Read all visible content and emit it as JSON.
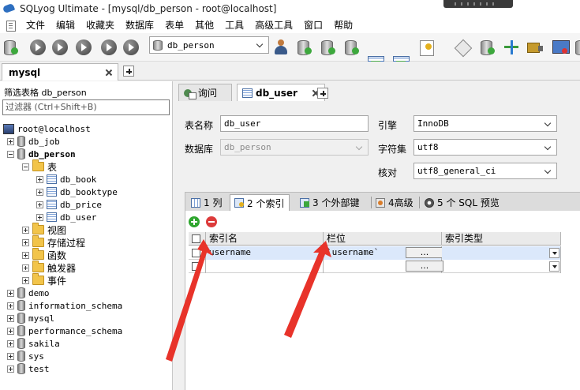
{
  "window": {
    "title": "SQLyog Ultimate - [mysql/db_person - root@localhost]"
  },
  "menu": {
    "items": [
      "文件",
      "编辑",
      "收藏夹",
      "数据库",
      "表单",
      "其他",
      "工具",
      "高级工具",
      "窗口",
      "帮助"
    ]
  },
  "toolbar": {
    "database_select": "db_person"
  },
  "connection_tab": {
    "label": "mysql"
  },
  "object_browser": {
    "filter_label": "筛选表格 db_person",
    "filter_placeholder": "过滤器 (Ctrl+Shift+B)",
    "root": "root@localhost",
    "db_job": "db_job",
    "db_person": "db_person",
    "tables_folder": "表",
    "tables": [
      "db_book",
      "db_booktype",
      "db_price",
      "db_user"
    ],
    "folders": [
      "视图",
      "存储过程",
      "函数",
      "触发器",
      "事件"
    ],
    "other_dbs": [
      "demo",
      "information_schema",
      "mysql",
      "performance_schema",
      "sakila",
      "sys",
      "test"
    ]
  },
  "editor_tabs": {
    "query": "询问",
    "table": "db_user"
  },
  "form": {
    "table_name_label": "表名称",
    "table_name": "db_user",
    "database_label": "数据库",
    "database": "db_person",
    "engine_label": "引擎",
    "engine": "InnoDB",
    "charset_label": "字符集",
    "charset": "utf8",
    "collation_label": "核对",
    "collation": "utf8_general_ci"
  },
  "sub_tabs": [
    "1 列",
    "2 个索引",
    "3 个外部键",
    "4高级",
    "5 个 SQL 预览"
  ],
  "index_grid": {
    "headers": [
      "索引名",
      "栏位",
      "索引类型"
    ],
    "rows": [
      {
        "name": "username",
        "columns": "`username`",
        "type": "",
        "button": "..."
      },
      {
        "name": "",
        "columns": "",
        "type": "",
        "button": "..."
      }
    ]
  }
}
